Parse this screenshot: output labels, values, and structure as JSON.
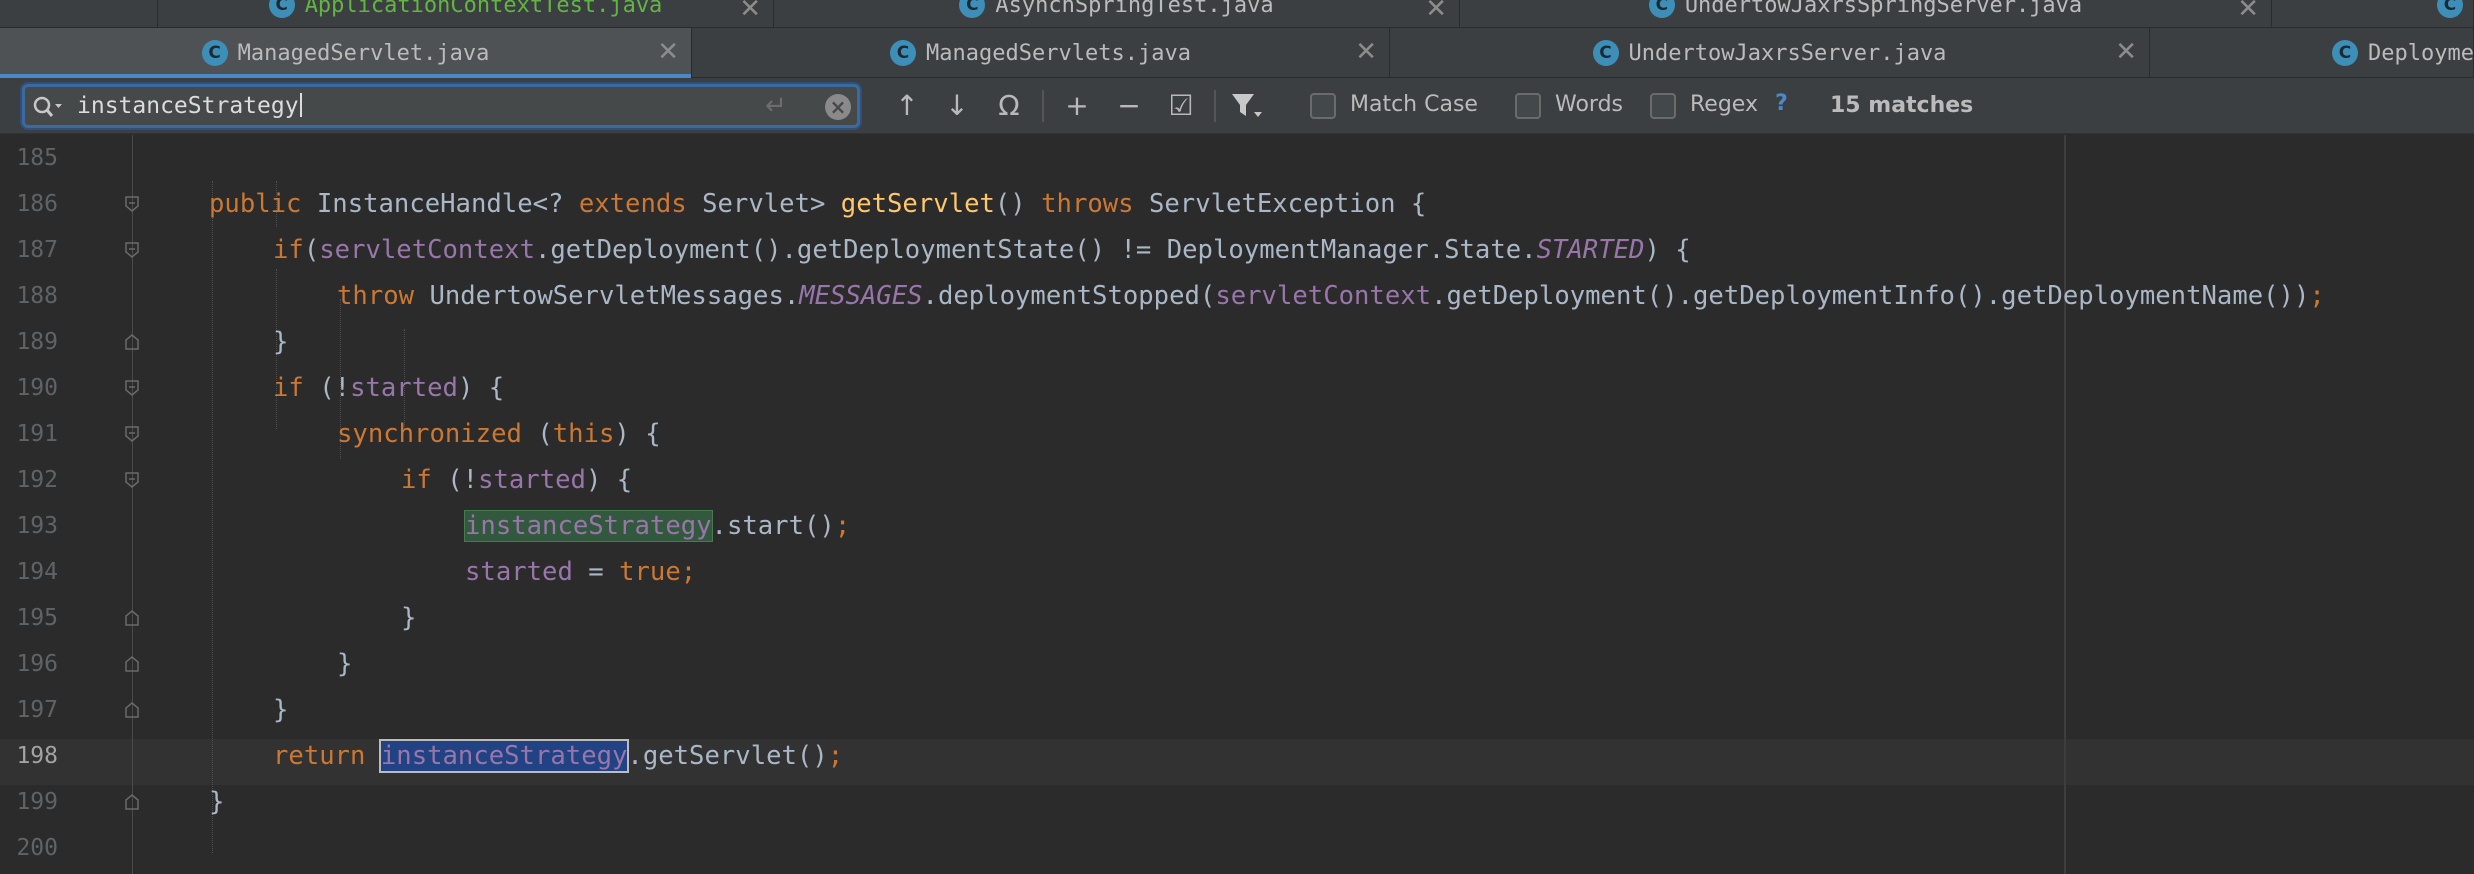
{
  "tabs_row1": [
    {
      "label": "ApplicationContextTest.java",
      "color": "#62b543"
    },
    {
      "label": "AsynchSpringTest.java"
    },
    {
      "label": "UndertowJaxrsSpringServer.java"
    },
    {
      "label": ""
    }
  ],
  "tabs_row2": [
    {
      "label": "ManagedServlet.java",
      "active": true
    },
    {
      "label": "ManagedServlets.java"
    },
    {
      "label": "UndertowJaxrsServer.java"
    },
    {
      "label": "Deployme"
    }
  ],
  "search": {
    "value": "instanceStrategy",
    "match_case_label": "Match Case",
    "words_label": "Words",
    "regex_label": "Regex",
    "help_label": "?",
    "matches_label": "15 matches"
  },
  "editor": {
    "current_line": "198",
    "lines": [
      {
        "n": "185"
      },
      {
        "n": "186"
      },
      {
        "n": "187"
      },
      {
        "n": "188"
      },
      {
        "n": "189"
      },
      {
        "n": "190"
      },
      {
        "n": "191"
      },
      {
        "n": "192"
      },
      {
        "n": "193"
      },
      {
        "n": "194"
      },
      {
        "n": "195"
      },
      {
        "n": "196"
      },
      {
        "n": "197"
      },
      {
        "n": "198"
      },
      {
        "n": "199"
      },
      {
        "n": "200"
      }
    ],
    "tokens": {
      "public": "public",
      "instance_handle": "InstanceHandle<? ",
      "extends": "extends",
      "servlet_gt": " Servlet> ",
      "get_servlet": "getServlet",
      "parens": "() ",
      "throws": "throws",
      "servlet_exception": " ServletException {",
      "if": "if",
      "paren_open": "(",
      "servlet_context": "servletContext",
      "get_deployment_state": ".getDeployment().getDeploymentState() != DeploymentManager.State.",
      "started_const": "STARTED",
      "close_brace_open": ") {",
      "throw": "throw",
      "undertow_messages": " UndertowServletMessages.",
      "messages_const": "MESSAGES",
      "deployment_stopped": ".deploymentStopped(",
      "deployment_info": ".getDeployment().getDeploymentInfo().getDeploymentName())",
      "semicolon": ";",
      "close_brace": "}",
      "if_space": "if",
      "not_open": " (!",
      "started": "started",
      "paren_brace": ") {",
      "synchronized": "synchronized",
      "space_open": " (",
      "this": "this",
      "instance_strategy": "instanceStrategy",
      "start_call": ".start()",
      "assign": " = ",
      "true": "true",
      "return": "return",
      "get_servlet_call": ".getServlet()"
    }
  }
}
